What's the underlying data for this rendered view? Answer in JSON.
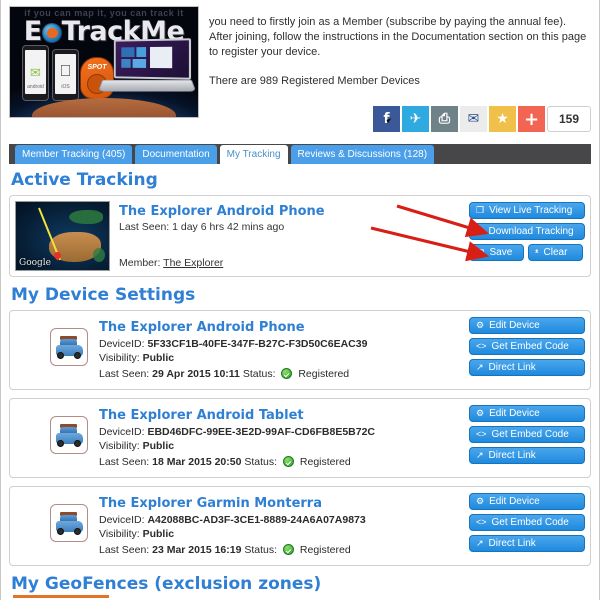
{
  "banner": {
    "tagline": "if you can map it, you can track it",
    "logo_text": "E",
    "logo_text2": "TrackMe",
    "alt": "EOTrackMe banner"
  },
  "intro": {
    "paragraph1": "you need to firstly join as a Member (subscribe by paying the annual fee). After joining, follow the instructions in the Documentation section on this page to register your device.",
    "paragraph2": "There are 989 Registered Member Devices"
  },
  "social": {
    "facebook": "f",
    "twitter": "✈",
    "print": "⎙",
    "email": "✉",
    "favorite": "★",
    "more": "+",
    "count": "159"
  },
  "tabs": [
    {
      "label": "Member Tracking (405)",
      "active": false
    },
    {
      "label": "Documentation",
      "active": false
    },
    {
      "label": "My Tracking",
      "active": true
    },
    {
      "label": "Reviews & Discussions (128)",
      "active": false
    }
  ],
  "active_tracking": {
    "heading": "Active Tracking",
    "device_name": "The Explorer Android Phone",
    "last_seen": "Last Seen: 1 day 6 hrs 42 mins ago",
    "member_label": "Member:",
    "member_name": "The Explorer",
    "map_attribution": "Google",
    "buttons": {
      "view_live": "View Live Tracking",
      "download": "Download Tracking",
      "save": "Save",
      "clear": "Clear"
    },
    "icons": {
      "view_live": "❐",
      "download": "↩",
      "save": "▤",
      "clear": "ᵜ"
    }
  },
  "device_settings": {
    "heading": "My Device Settings",
    "labels": {
      "device_id": "DeviceID:",
      "visibility": "Visibility:",
      "last_seen": "Last Seen:",
      "status": "Status:"
    },
    "buttons": {
      "edit": "Edit Device",
      "embed": "Get Embed Code",
      "direct": "Direct Link"
    },
    "button_icons": {
      "edit": "⚙",
      "embed": "<>",
      "direct": "↗"
    },
    "devices": [
      {
        "name": "The Explorer Android Phone",
        "device_id": "5F33CF1B-40FE-347F-B27C-F3D50C6EAC39",
        "visibility": "Public",
        "last_seen": "29 Apr 2015 10:11",
        "status": "Registered"
      },
      {
        "name": "The Explorer Android Tablet",
        "device_id": "EBD46DFC-99EE-3E2D-99AF-CD6FB8E5B72C",
        "visibility": "Public",
        "last_seen": "18 Mar 2015 20:50",
        "status": "Registered"
      },
      {
        "name": "The Explorer Garmin Monterra",
        "device_id": "A42088BC-AD3F-3CE1-8889-24A6A07A9873",
        "visibility": "Public",
        "last_seen": "23 Mar 2015 16:19",
        "status": "Registered"
      }
    ]
  },
  "geofences": {
    "heading": "My GeoFences (exclusion zones)"
  },
  "annotations": {
    "arrow_color": "#d81f16",
    "arrow1_target": "Download Tracking",
    "arrow2_target": "Save"
  },
  "colors": {
    "heading_blue": "#2f7fd4",
    "tab_blue": "#4a9fe8",
    "tabbar_dark": "#47474a",
    "button_blue": "#1f8ade",
    "accent_orange": "#e2742a",
    "status_green": "#2e9c2e"
  }
}
